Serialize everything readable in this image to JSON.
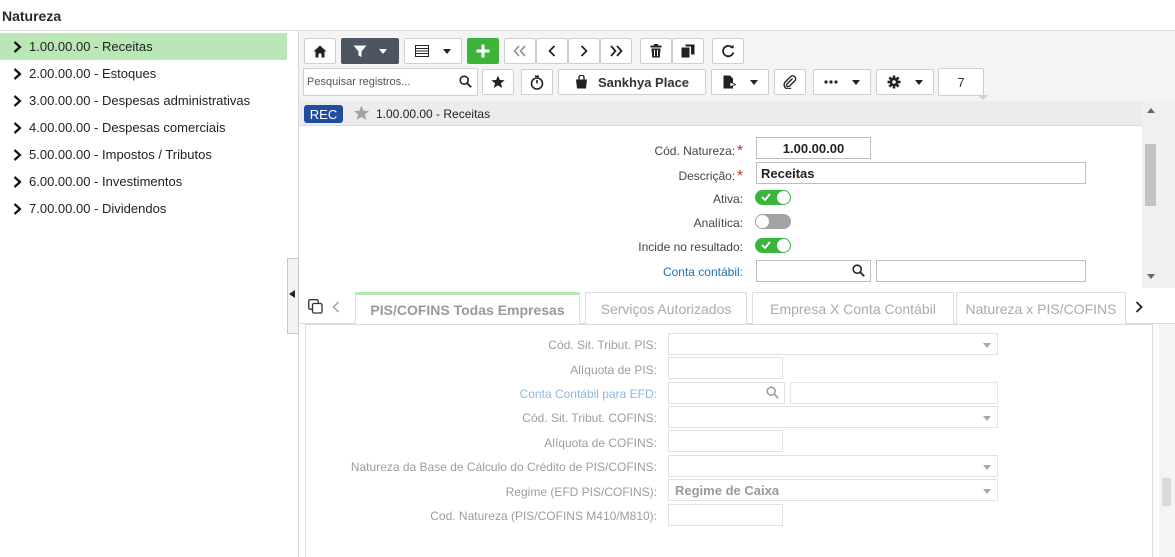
{
  "app": {
    "title": "Natureza"
  },
  "sidebar": {
    "items": [
      {
        "label": "1.00.00.00 - Receitas",
        "active": true
      },
      {
        "label": "2.00.00.00 - Estoques",
        "active": false
      },
      {
        "label": "3.00.00.00 - Despesas administrativas",
        "active": false
      },
      {
        "label": "4.00.00.00 - Despesas comerciais",
        "active": false
      },
      {
        "label": "5.00.00.00 - Impostos / Tributos",
        "active": false
      },
      {
        "label": "6.00.00.00 - Investimentos",
        "active": false
      },
      {
        "label": "7.00.00.00 - Dividendos",
        "active": false
      }
    ]
  },
  "toolbar": {
    "search_placeholder": "Pesquisar registros...",
    "place_label": "Sankhya Place",
    "record_count": "7",
    "icons": [
      "home-icon",
      "filter-icon",
      "grid-view-icon",
      "add-icon",
      "first-page-icon",
      "previous-icon",
      "next-icon",
      "last-page-icon",
      "delete-icon",
      "duplicate-icon",
      "refresh-icon",
      "search-icon",
      "star-icon",
      "timer-icon",
      "place-icon",
      "report-icon",
      "attachment-icon",
      "more-icon",
      "settings-icon"
    ]
  },
  "record": {
    "badge": "REC",
    "title": "1.00.00.00 - Receitas"
  },
  "form": {
    "cod_label": "Cód. Natureza:",
    "cod_value": "1.00.00.00",
    "desc_label": "Descrição:",
    "desc_value": "Receitas",
    "ativa_label": "Ativa:",
    "ativa": true,
    "analitica_label": "Analítica:",
    "analitica": false,
    "incide_label": "Incide no resultado:",
    "incide": true,
    "conta_label": "Conta contábil:",
    "conta_value": "",
    "conta_desc": ""
  },
  "tabs": [
    {
      "label": "PIS/COFINS Todas Empresas",
      "active": true
    },
    {
      "label": "Serviços Autorizados",
      "active": false
    },
    {
      "label": "Empresa X Conta Contábil",
      "active": false
    },
    {
      "label": "Natureza x PIS/COFINS",
      "active": false
    }
  ],
  "subform": {
    "cst_pis_label": "Cód. Sit. Tribut. PIS:",
    "cst_pis_value": "",
    "aliq_pis_label": "Alíquota de PIS:",
    "aliq_pis_value": "",
    "conta_efd_label": "Conta Contábil para EFD:",
    "conta_efd_value": "",
    "conta_efd_desc": "",
    "cst_cofins_label": "Cód. Sit. Tribut. COFINS:",
    "cst_cofins_value": "",
    "aliq_cofins_label": "Alíquota de COFINS:",
    "aliq_cofins_value": "",
    "nat_base_label": "Natureza da Base de Cálculo do Crédito de PIS/COFINS:",
    "nat_base_value": "",
    "regime_label": "Regime (EFD PIS/COFINS):",
    "regime_value": "Regime de Caixa",
    "cod_nat_label": "Cod. Natureza (PIS/COFINS M410/M810):",
    "cod_nat_value": ""
  },
  "colors": {
    "active_item": "#b9e7b6",
    "primary_dark": "#4c5560",
    "add_green": "#3cb53a",
    "badge_blue": "#1f4ea0",
    "toggle_on": "#39b53a",
    "required": "#c42b1c",
    "link": "#1f6fb5"
  }
}
